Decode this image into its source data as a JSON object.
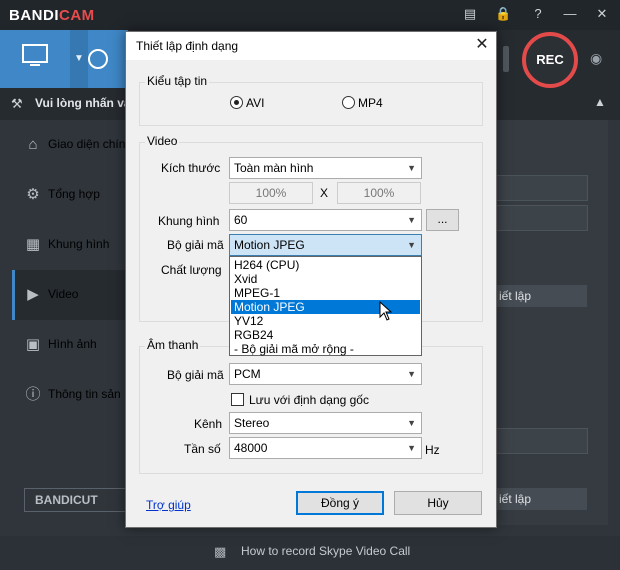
{
  "app": {
    "logo_part1": "BANDI",
    "logo_part2": "CAM",
    "rec_label": "REC",
    "notice": "Vui lòng nhấn và",
    "sidebar": [
      {
        "label": "Giao diện chín",
        "icon": "home-icon"
      },
      {
        "label": "Tổng hợp",
        "icon": "gear-icon"
      },
      {
        "label": "Khung hình",
        "icon": "film-icon"
      },
      {
        "label": "Video",
        "icon": "video-icon"
      },
      {
        "label": "Hình ảnh",
        "icon": "image-icon"
      },
      {
        "label": "Thông tin sản",
        "icon": "info-icon"
      }
    ],
    "right_btn_label": "iết lập",
    "bandicut": "BANDICUT",
    "footer_text": "How to record Skype Video Call"
  },
  "dialog": {
    "title": "Thiết lập định dạng",
    "file_type": {
      "group_label": "Kiểu tập tin",
      "options": [
        "AVI",
        "MP4"
      ],
      "selected": "AVI"
    },
    "video": {
      "group_label": "Video",
      "size_label": "Kích thước",
      "size_value": "Toàn màn hình",
      "width_pct": "100%",
      "x_label": "X",
      "height_pct": "100%",
      "fps_label": "Khung hình",
      "fps_value": "60",
      "more_button": "...",
      "codec_label": "Bộ giải mã",
      "codec_value": "Motion JPEG",
      "quality_label": "Chất lượng",
      "codec_options": [
        "H264 (CPU)",
        "Xvid",
        "MPEG-1",
        "Motion JPEG",
        "YV12",
        "RGB24",
        " - Bộ giải mã mở rộng -"
      ],
      "codec_highlighted": "Motion JPEG"
    },
    "audio": {
      "group_label": "Âm thanh",
      "codec_label": "Bộ giải mã",
      "codec_value": "PCM",
      "keep_original_label": "Lưu với định dạng gốc",
      "channel_label": "Kênh",
      "channel_value": "Stereo",
      "freq_label": "Tần số",
      "freq_value": "48000",
      "freq_unit": "Hz"
    },
    "help_link": "Trợ giúp",
    "ok_button": "Đồng ý",
    "cancel_button": "Hủy"
  },
  "colors": {
    "accent": "#3f87c6",
    "rec": "#e34b4b",
    "selection": "#0078d7"
  }
}
